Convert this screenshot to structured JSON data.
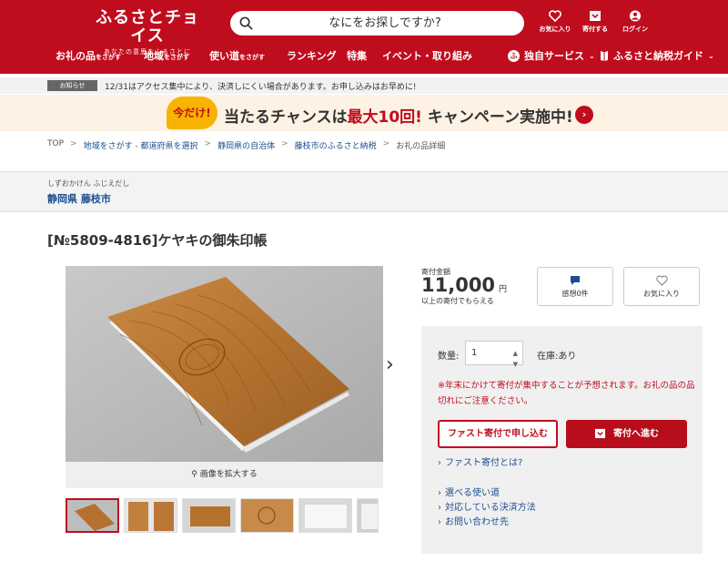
{
  "header": {
    "logo": "ふるさとチョイス",
    "tagline": "あなたの意思をふるさとに",
    "search_placeholder": "なにをお探しですか?",
    "icons": [
      {
        "label": "お気に入り",
        "icon": "heart-icon"
      },
      {
        "label": "寄付する",
        "icon": "gift-icon"
      },
      {
        "label": "ログイン",
        "icon": "user-icon"
      }
    ],
    "nav": [
      {
        "label": "お礼の品",
        "sub": "をさがす"
      },
      {
        "label": "地域",
        "sub": "をさがす"
      },
      {
        "label": "使い道",
        "sub": "をさがす"
      },
      {
        "label": "ランキング",
        "sub": ""
      },
      {
        "label": "特集",
        "sub": ""
      },
      {
        "label": "イベント・取り組み",
        "sub": ""
      }
    ],
    "nav_right": [
      {
        "label": "独自サービス",
        "icon": "service-icon"
      },
      {
        "label": "ふるさと納税ガイド",
        "icon": "book-icon"
      }
    ]
  },
  "notice": {
    "badge": "お知らせ",
    "text": "12/31はアクセス集中により、決済しにくい場合があります。お申し込みはお早めに!"
  },
  "campaign": {
    "tag": "今だけ!",
    "prefix": "当たるチャンスは",
    "highlight": "最大10回!",
    "suffix": "キャンペーン実施中!"
  },
  "breadcrumb": [
    {
      "label": "TOP",
      "link": false
    },
    {
      "label": "地域をさがす - 都道府県を選択",
      "link": true
    },
    {
      "label": "静岡県の自治体",
      "link": true
    },
    {
      "label": "藤枝市のふるさと納税",
      "link": true
    },
    {
      "label": "お礼の品詳細",
      "link": false
    }
  ],
  "region": {
    "ruby": "しずおかけん ふじえだし",
    "name": "静岡県 藤枝市"
  },
  "product": {
    "title": "[№5809-4816]ケヤキの御朱印帳",
    "zoom_label": "画像を拡大する",
    "donation_label": "寄付金額",
    "amount": "11,000",
    "unit": "円",
    "amount_note": "以上の寄付でもらえる",
    "impressions": "感想0件",
    "favorite": "お気に入り"
  },
  "panel": {
    "qty_label": "数量:",
    "qty_value": "1",
    "stock": "在庫:あり",
    "warning": "※年末にかけて寄付が集中することが予想されます。お礼の品の品切れにご注意ください。",
    "fast_button": "ファスト寄付で申し込む",
    "donate_button": "寄付へ進む",
    "fast_link": "ファスト寄付とは?",
    "links": [
      "選べる使い道",
      "対応している決済方法",
      "お問い合わせ先"
    ]
  },
  "colors": {
    "brand_red": "#c00d1e",
    "link_blue": "#1d4f91",
    "campaign_bg": "#fdf2e3",
    "campaign_tag": "#f8b300"
  }
}
